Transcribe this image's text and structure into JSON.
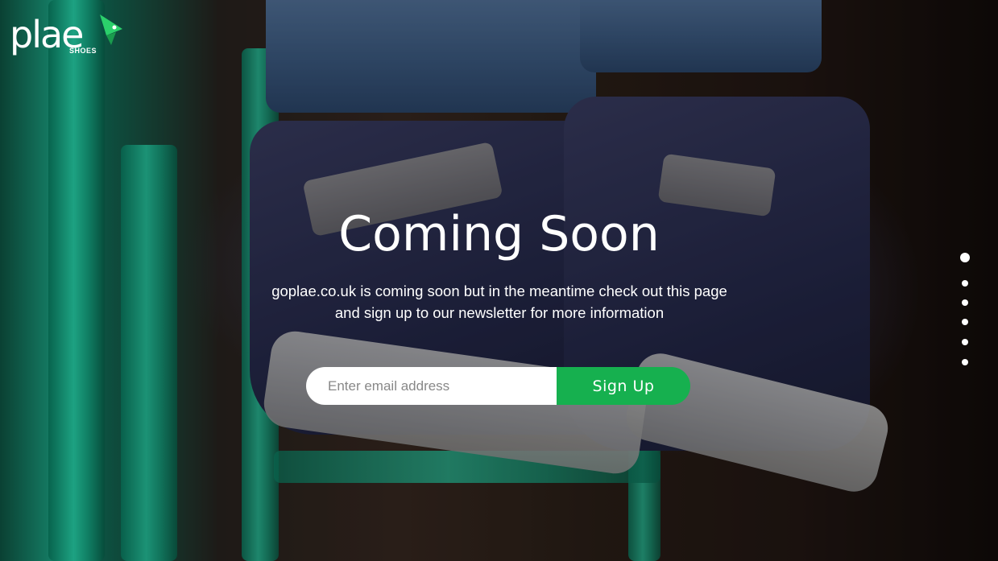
{
  "brand": {
    "name": "plae",
    "sub": "SHOES",
    "accent_color": "#2bd06b"
  },
  "hero": {
    "title": "Coming Soon",
    "subtitle_line1": "goplae.co.uk is coming soon but in the meantime check out this page",
    "subtitle_line2": "and sign up to our newsletter for more information"
  },
  "signup": {
    "placeholder": "Enter email address",
    "value": "",
    "button_label": "Sign Up",
    "button_color": "#16b04f"
  },
  "slider": {
    "total_slides": 6,
    "active_index": 0
  }
}
